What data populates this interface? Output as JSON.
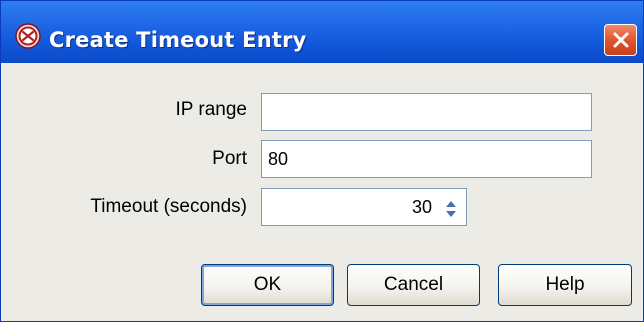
{
  "window": {
    "title": "Create Timeout Entry",
    "icon": "app-emblem-icon",
    "close_icon": "close-icon"
  },
  "form": {
    "ip_range": {
      "label": "IP range",
      "value": ""
    },
    "port": {
      "label": "Port",
      "value": "80"
    },
    "timeout": {
      "label": "Timeout (seconds)",
      "value": "30",
      "control_icon": "spinner-arrows-icon"
    }
  },
  "buttons": {
    "ok": "OK",
    "cancel": "Cancel",
    "help": "Help"
  },
  "colors": {
    "titlebar": "#0b4ac8",
    "close_button": "#e2552d",
    "panel": "#ecebe5",
    "field_border": "#7f9db9"
  }
}
